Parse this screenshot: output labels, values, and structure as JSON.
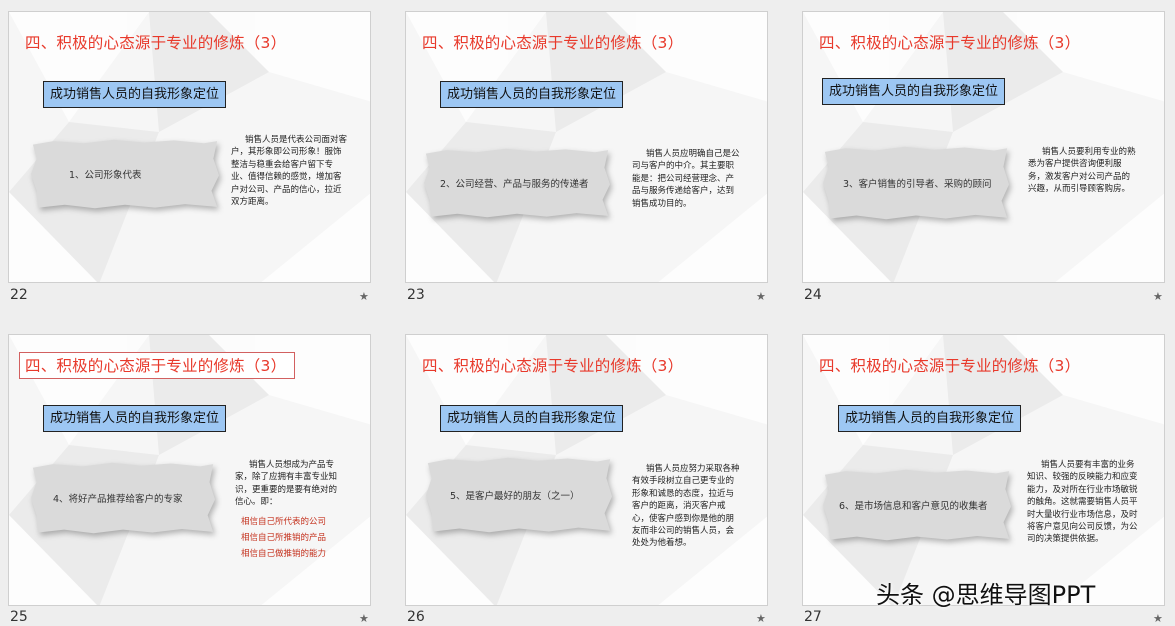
{
  "slides": [
    {
      "number": "22",
      "title": "四、积极的心态源于专业的修炼（3）",
      "subtitle": "成功销售人员的自我形象定位",
      "point": "1、公司形象代表",
      "description": "销售人员是代表公司面对客户，其形象即公司形象！服饰整洁与稳重会给客户留下专业、值得信赖的感觉，增加客户对公司、产品的信心，拉近双方距离。"
    },
    {
      "number": "23",
      "title": "四、积极的心态源于专业的修炼（3）",
      "subtitle": "成功销售人员的自我形象定位",
      "point": "2、公司经营、产品与服务的传递者",
      "description": "销售人员应明确自己是公司与客户的中介。其主要职能是：把公司经营理念、产品与服务传递给客户，达到销售成功目的。"
    },
    {
      "number": "24",
      "title": "四、积极的心态源于专业的修炼（3）",
      "subtitle": "成功销售人员的自我形象定位",
      "point": "3、客户销售的引导者、采购的顾问",
      "description": "销售人员要利用专业的熟悉为客户提供咨询便利服务，激发客户对公司产品的兴趣，从而引导顾客购房。"
    },
    {
      "number": "25",
      "title": "四、积极的心态源于专业的修炼（3）",
      "subtitle": "成功销售人员的自我形象定位",
      "point": "4、将好产品推荐给客户的专家",
      "description": "销售人员想成为产品专家，除了应拥有丰富专业知识，更重要的是要有绝对的信心。即：",
      "highlights": [
        "相信自己所代表的公司",
        "相信自己所推销的产品",
        "相信自己做推销的能力"
      ]
    },
    {
      "number": "26",
      "title": "四、积极的心态源于专业的修炼（3）",
      "subtitle": "成功销售人员的自我形象定位",
      "point": "5、是客户最好的朋友（之一）",
      "description": "销售人员应努力采取各种有效手段树立自己更专业的形象和诚恳的态度，拉近与客户的距离，消灭客户戒心，使客户感到你是他的朋友而非公司的销售人员，会处处为他着想。"
    },
    {
      "number": "27",
      "title": "四、积极的心态源于专业的修炼（3）",
      "subtitle": "成功销售人员的自我形象定位",
      "point": "6、是市场信息和客户意见的收集者",
      "description": "销售人员要有丰富的业务知识、较强的反映能力和应变能力，及对所在行业市场敏锐的触角。这就需要销售人员平时大量收行业市场信息，及时将客户意见向公司反馈，为公司的决策提供依据。"
    }
  ],
  "star": "★",
  "watermark": "头条 @思维导图PPT",
  "colors": {
    "title": "#e8392b",
    "subtitle_bg": "#9dc7f3",
    "highlight": "#c5331f"
  }
}
